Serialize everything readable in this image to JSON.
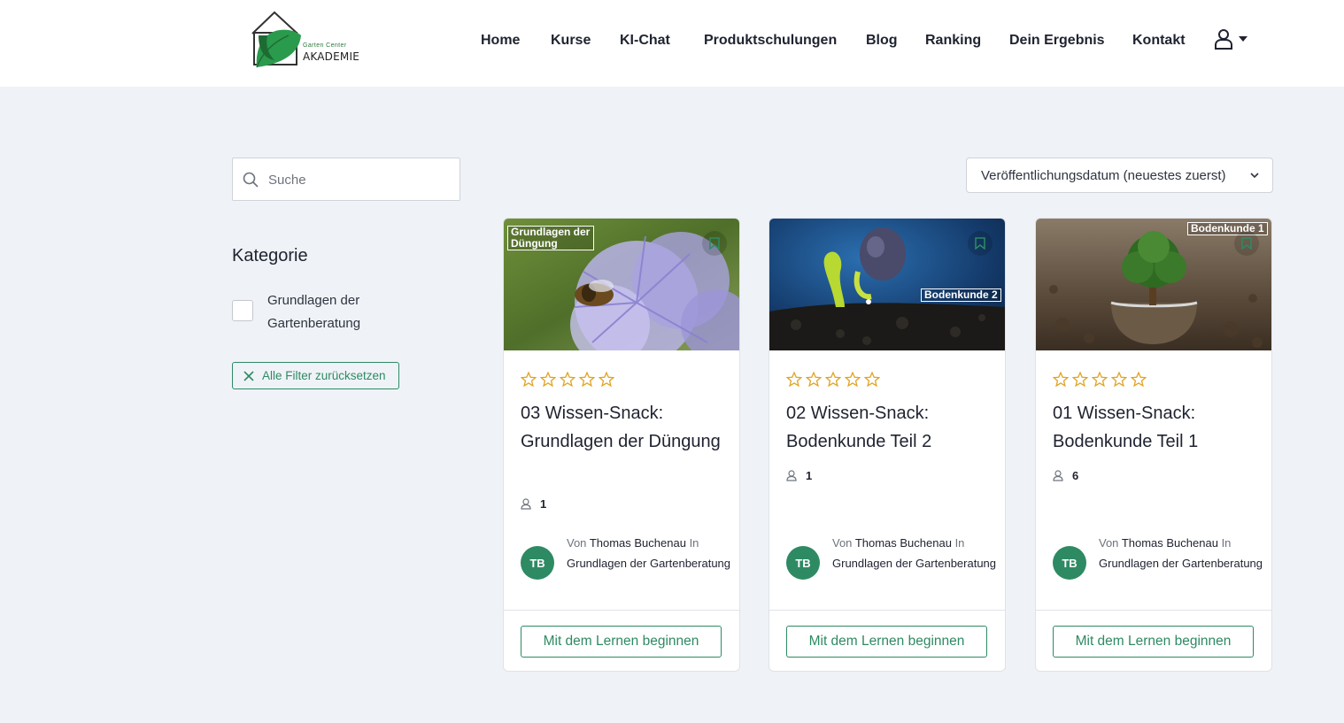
{
  "header": {
    "logo": {
      "line1": "Garten Center",
      "line2": "AKADEMIE"
    },
    "nav": [
      {
        "label": "Home"
      },
      {
        "label": "Kurse"
      },
      {
        "label": "KI-Chat"
      },
      {
        "label": "Produktschulungen"
      },
      {
        "label": "Blog"
      },
      {
        "label": "Ranking"
      },
      {
        "label": "Dein Ergebnis"
      },
      {
        "label": "Kontakt"
      }
    ],
    "user_icon": "user-icon",
    "accent_color": "#2e8a63"
  },
  "sidebar": {
    "search_placeholder": "Suche",
    "category_title": "Kategorie",
    "category_option": "Grundlagen der Gartenberatung",
    "reset_label": "Alle Filter zurücksetzen"
  },
  "sort": {
    "selected": "Veröffentlichungsdatum (neuestes zuerst)"
  },
  "courses": [
    {
      "image_label": "Grundlagen der Düngung",
      "title": "03 Wissen-Snack: Grundlagen der Düngung",
      "rating": 0,
      "enrolled": "1",
      "by": "Von",
      "author": "Thomas Buchenau",
      "in": "In",
      "category": "Grundlagen der Gartenberatung",
      "initials": "TB",
      "cta": "Mit dem Lernen beginnen"
    },
    {
      "image_label": "Bodenkunde 2",
      "title": "02 Wissen-Snack: Bodenkunde Teil 2",
      "rating": 0,
      "enrolled": "1",
      "by": "Von",
      "author": "Thomas Buchenau",
      "in": "In",
      "category": "Grundlagen der Gartenberatung",
      "initials": "TB",
      "cta": "Mit dem Lernen beginnen"
    },
    {
      "image_label": "Bodenkunde 1",
      "title": "01 Wissen-Snack: Bodenkunde Teil 1",
      "rating": 0,
      "enrolled": "6",
      "by": "Von",
      "author": "Thomas Buchenau",
      "in": "In",
      "category": "Grundlagen der Gartenberatung",
      "initials": "TB",
      "cta": "Mit dem Lernen beginnen"
    }
  ]
}
